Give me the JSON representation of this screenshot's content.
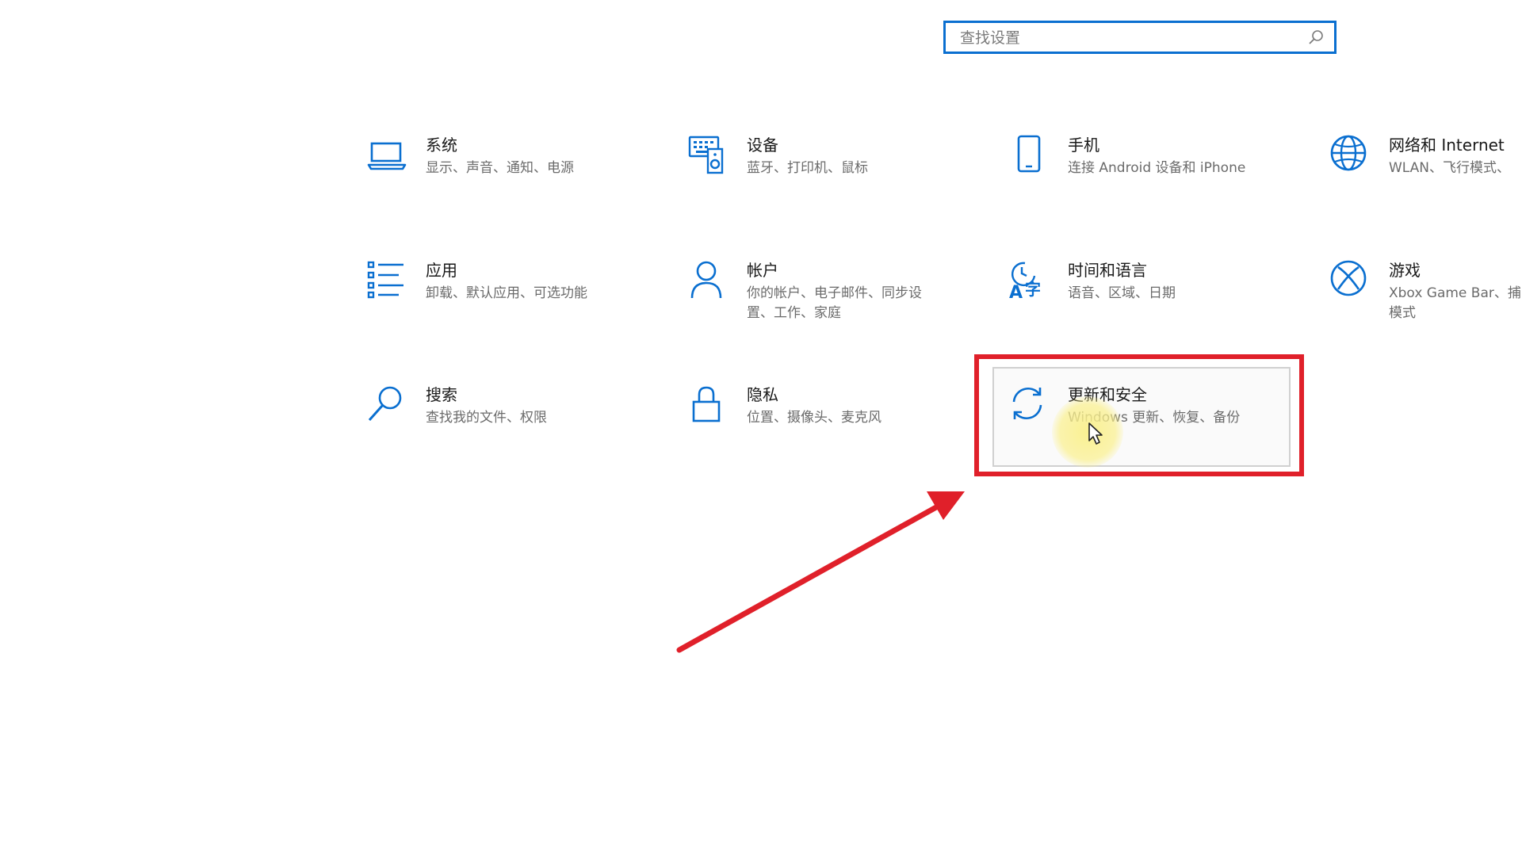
{
  "search": {
    "placeholder": "查找设置"
  },
  "tiles": [
    {
      "title": "系统",
      "desc": "显示、声音、通知、电源"
    },
    {
      "title": "设备",
      "desc": "蓝牙、打印机、鼠标"
    },
    {
      "title": "手机",
      "desc": "连接 Android 设备和 iPhone"
    },
    {
      "title": "网络和 Internet",
      "desc": "WLAN、飞行模式、"
    },
    {
      "title": "应用",
      "desc": "卸载、默认应用、可选功能"
    },
    {
      "title": "帐户",
      "desc": "你的帐户、电子邮件、同步设置、工作、家庭"
    },
    {
      "title": "时间和语言",
      "desc": "语音、区域、日期"
    },
    {
      "title": "游戏",
      "desc": "Xbox Game Bar、捕模式"
    },
    {
      "title": "搜索",
      "desc": "查找我的文件、权限"
    },
    {
      "title": "隐私",
      "desc": "位置、摄像头、麦克风"
    },
    {
      "title": "更新和安全",
      "desc": "Windows 更新、恢复、备份"
    }
  ],
  "colors": {
    "accent": "#0a6fd0",
    "annotation": "#e0202a",
    "cursor_highlight": "#faf08c"
  }
}
